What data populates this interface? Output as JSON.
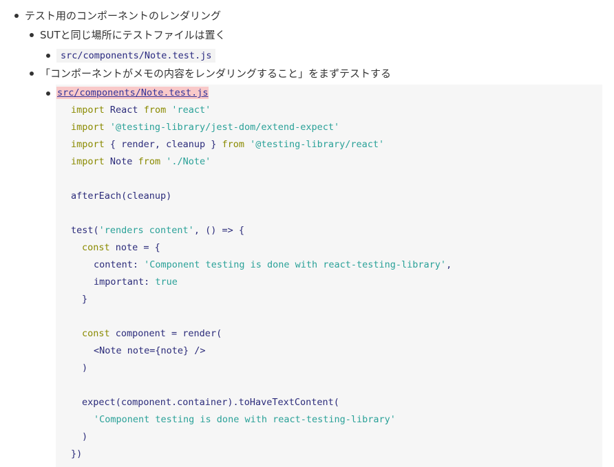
{
  "outline": {
    "item1": "テスト用のコンポーネントのレンダリング",
    "item1_1": "SUTと同じ場所にテストファイルは置く",
    "item1_1_1_code": "src/components/Note.test.js",
    "item2": "「コンポーネントがメモの内容をレンダリングすること」をまずテストする",
    "item2_1_file": "src/components/Note.test.js"
  },
  "code": {
    "l1": {
      "a": "import",
      "b": " React ",
      "c": "from",
      "d": " 'react'"
    },
    "l2": {
      "a": "import",
      "b": " '@testing-library/jest-dom/extend-expect'"
    },
    "l3": {
      "a": "import",
      "b": " { render, cleanup } ",
      "c": "from",
      "d": " '@testing-library/react'"
    },
    "l4": {
      "a": "import",
      "b": " Note ",
      "c": "from",
      "d": " './Note'"
    },
    "l5": "afterEach(cleanup)",
    "l6": {
      "a": "test(",
      "b": "'renders content'",
      "c": ", () => {"
    },
    "l7": {
      "a": "const",
      "b": " note = {"
    },
    "l8": {
      "a": "content: ",
      "b": "'Component testing is done with react-testing-library'",
      "c": ","
    },
    "l9": {
      "a": "important: ",
      "b": "true"
    },
    "l10": "}",
    "l11": {
      "a": "const",
      "b": " component = render("
    },
    "l12": "<Note note={note} />",
    "l13": ")",
    "l14": "expect(component.container).toHaveTextContent(",
    "l15": "'Component testing is done with react-testing-library'",
    "l16": ")",
    "l17": "})"
  }
}
